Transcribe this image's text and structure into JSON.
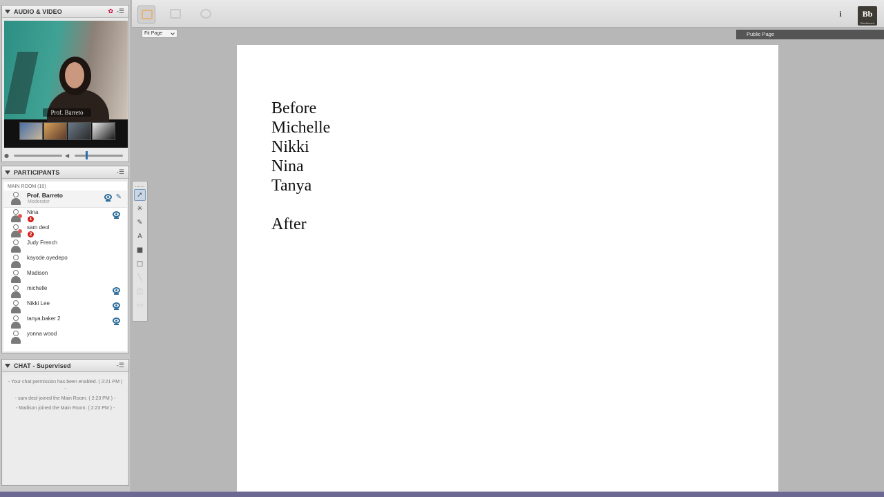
{
  "audio_video": {
    "title": "AUDIO & VIDEO",
    "video_name": "Prof. Barreto",
    "thumbnails": 4
  },
  "participants": {
    "title": "PARTICIPANTS",
    "room_label": "MAIN ROOM  (10)",
    "moderator": {
      "name": "Prof. Barreto",
      "role": "Moderator"
    },
    "list": [
      {
        "name": "Nina",
        "badge": "1",
        "camera": true
      },
      {
        "name": "sam deol",
        "badge": "2",
        "camera": false
      },
      {
        "name": "Judy French",
        "badge": "",
        "camera": false
      },
      {
        "name": "kayode.oyedepo",
        "badge": "",
        "camera": false
      },
      {
        "name": "Madison",
        "badge": "",
        "camera": false
      },
      {
        "name": "michelle",
        "badge": "",
        "camera": true
      },
      {
        "name": "Nikki Lee",
        "badge": "",
        "camera": true
      },
      {
        "name": "tanya.baker 2",
        "badge": "",
        "camera": true
      },
      {
        "name": "yonna wood",
        "badge": "",
        "camera": false
      }
    ]
  },
  "chat": {
    "title": "CHAT - Supervised",
    "messages": [
      "- Your chat permission has been enabled. ( 2:21 PM ) -",
      "- sam deol joined the Main Room. ( 2:23 PM ) -",
      "- Madison joined the Main Room. ( 2:23 PM ) -"
    ]
  },
  "whiteboard": {
    "zoom_label": "Fit Page",
    "public_page_label": "Public Page",
    "slide_lines": [
      "Before",
      "Michelle",
      "Nikki",
      "Nina",
      "Tanya"
    ],
    "slide_after": "After"
  },
  "topbar": {
    "info_label": "i",
    "logo_text": "Bb",
    "logo_sub": "Blackboard"
  },
  "colors": {
    "accent_blue": "#2d6c9a",
    "badge_red": "#d0221a",
    "bottom_bar": "#6c6891"
  }
}
